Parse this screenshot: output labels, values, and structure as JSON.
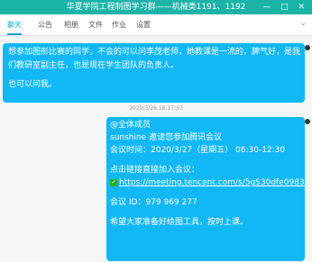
{
  "window": {
    "title": "华夏学院工程制图学习群——机械类1191、1192",
    "controls": "— □ ✕"
  },
  "tabs": [
    {
      "label": "聊天"
    },
    {
      "label": "公告"
    },
    {
      "label": "相册"
    },
    {
      "label": "文件"
    },
    {
      "label": "作业"
    },
    {
      "label": "设置"
    }
  ],
  "messages": {
    "first": {
      "lines": [
        "想参加图形比赛的同学，不会的可以问李茂老师，她教课是一流的，脾气好，是我",
        "们教研室副主任，也是现在学生团队的负责人。",
        "",
        "也可以问我。"
      ]
    },
    "timestamp": "2020/3/26 16:17:37",
    "second": {
      "mention": "@全体成员",
      "invite": "sunshine 邀请您参加腾讯会议",
      "meeting_time": "会议时间：2020/3/27（星期五） 06:30-12:30",
      "join_hint": "点击链接直接加入会议：",
      "link": "https://meeting.tencent.com/s/5gS30dfe09837",
      "meeting_id": "会议 ID：979 969 277",
      "note": "希望大家准备好绘图工具，按时上课。"
    }
  }
}
